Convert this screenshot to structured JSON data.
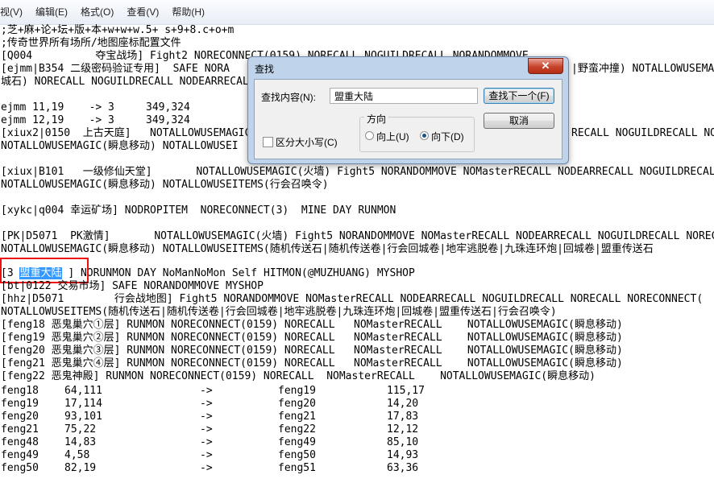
{
  "menu": [
    "视(V)",
    "编辑(E)",
    "格式(O)",
    "查看(V)",
    "帮助(H)"
  ],
  "lines": [
    ";芝+麻+论+坛+版+本+w+w+w.5+ s+9+8.c+o+m",
    ";传奇世界所有场所/地图座标配置文件",
    "[Q004          夺宝战场] Fight2 NORECONNECT(0159) NORECALL NOGUILDRECALL NORANDOMMOVE",
    "[ejmm|B354 二级密码验证专用]  SAFE NORA",
    "城石) NORECALL NOGUILDRECALL NODEARRECALL",
    "",
    "ejmm 11,19    -> 3     349,324",
    "ejmm 12,19    -> 3     349,324",
    "[xiux2|0150  上古天庭]   NOTALLOWUSEMAGIC",
    "NOTALLOWUSEMAGIC(瞬息移动) NOTALLOWUSEI",
    "",
    "[xiux|B101   一级修仙天堂]       NOTALLOWUSEMAGIC(火墙) Fight5 NORANDOMMOVE NOMasterRECALL NODEARRECALL NOGUILDRECALL",
    "NOTALLOWUSEMAGIC(瞬息移动) NOTALLOWUSEITEMS(行会召唤令)",
    "",
    "[xykc|q004 幸运矿场] NODROPITEM  NORECONNECT(3)  MINE DAY RUNMON",
    "",
    "[PK|D5071  PK激情]       NOTALLOWUSEMAGIC(火墙) Fight5 NORANDOMMOVE NOMasterRECALL NODEARRECALL NOGUILDRECALL NORECALL",
    "NOTALLOWUSEMAGIC(瞬息移动) NOTALLOWUSEITEMS(随机传送石|随机传送卷|行会回城卷|地牢逃脱卷|九珠连环炮|回城卷|盟重传送石",
    "",
    "[3 ",
    "[bt|0122 交易市场] SAFE NORANDOMMOVE MYSHOP",
    "[hhz|D5071        行会战地图] Fight5 NORANDOMMOVE NOMasterRECALL NODEARRECALL NOGUILDRECALL NORECALL NORECONNECT(",
    "NOTALLOWUSEITEMS(随机传送石|随机传送卷|行会回城卷|地牢逃脱卷|九珠连环炮|回城卷|盟重传送石|行会召唤令)",
    "[feng18 恶鬼巢穴①层] RUNMON NORECONNECT(0159) NORECALL   NOMasterRECALL    NOTALLOWUSEMAGIC(瞬息移动)",
    "[feng19 恶鬼巢穴②层] RUNMON NORECONNECT(0159) NORECALL   NOMasterRECALL    NOTALLOWUSEMAGIC(瞬息移动)",
    "[feng20 恶鬼巢穴③层] RUNMON NORECONNECT(0159) NORECALL   NOMasterRECALL    NOTALLOWUSEMAGIC(瞬息移动)",
    "[feng21 恶鬼巢穴④层] RUNMON NORECONNECT(0159) NORECALL   NOMasterRECALL    NOTALLOWUSEMAGIC(瞬息移动)",
    "[feng22 恶鬼神殿] RUNMON NORECONNECT(0159) NORECALL  NOMasterRECALL    NOTALLOWUSEMAGIC(瞬息移动)"
  ],
  "highlight": {
    "selected": "盟重大陆",
    "rest": " ] NORUNMON DAY NoManNoMon Self HITMON(@MUZHUANG) MYSHOP"
  },
  "dialog_right_fragments": [
    {
      "text": "|野蛮冲撞) NOTALLOWUSEMAGIC"
    },
    {
      "text": "RECALL NOGUILDRECALL NO"
    }
  ],
  "portals": [
    [
      "feng18",
      "64,111",
      "->",
      "feng19",
      "115,17"
    ],
    [
      "feng19",
      "17,114",
      "->",
      "feng20",
      "14,20"
    ],
    [
      "feng20",
      "93,101",
      "->",
      "feng21",
      "17,83"
    ],
    [
      "feng21",
      "75,22",
      "->",
      "feng22",
      "12,12"
    ],
    [
      "feng48",
      "14,83",
      "->",
      "feng49",
      "85,10"
    ],
    [
      "feng49",
      "4,58",
      "->",
      "feng50",
      "14,93"
    ],
    [
      "feng50",
      "82,19",
      "->",
      "feng51",
      "63,36"
    ]
  ],
  "find_dialog": {
    "title": "查找",
    "close": "✕",
    "find_label": "查找内容(N):",
    "find_value": "盟重大陆",
    "find_next_button": "查找下一个(F)",
    "cancel_button": "取消",
    "direction_label": "方向",
    "up_label": "向上(U)",
    "down_label": "向下(D)",
    "match_case_label": "区分大小写(C)",
    "direction_selected": "down",
    "match_case_checked": false
  }
}
